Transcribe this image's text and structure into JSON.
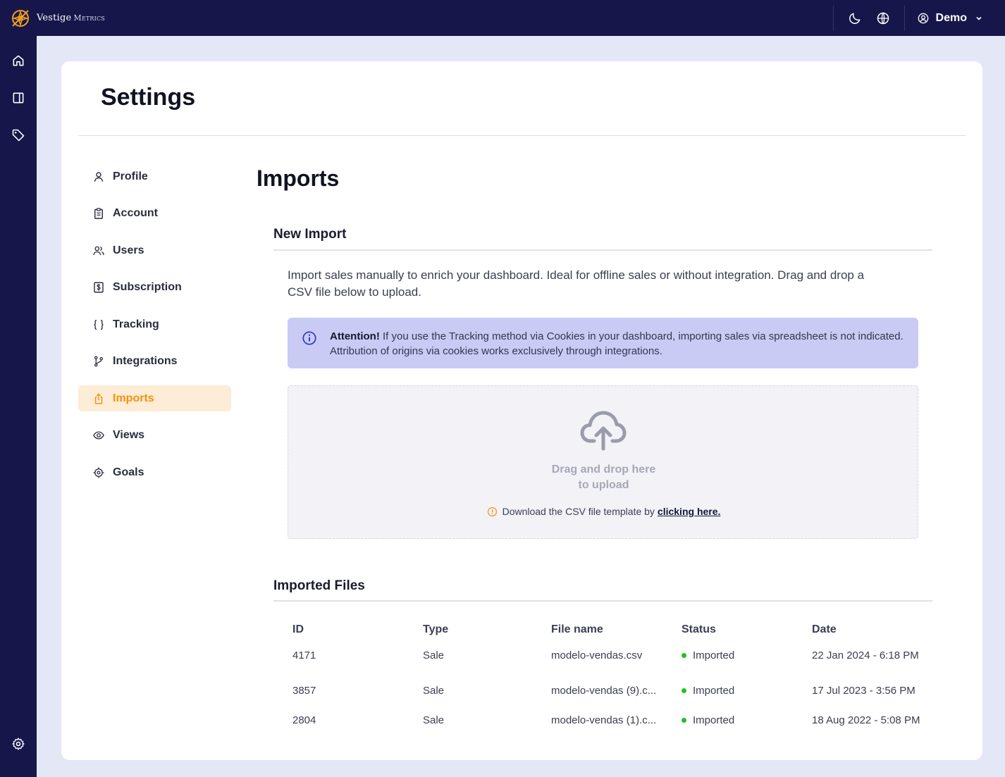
{
  "app": {
    "brand_name": "Vestige",
    "brand_suffix": "Metrics",
    "user_name": "Demo"
  },
  "page": {
    "title": "Settings",
    "section_title": "Imports"
  },
  "nav": {
    "items": [
      {
        "label": "Profile",
        "icon": "user-icon"
      },
      {
        "label": "Account",
        "icon": "clipboard-icon"
      },
      {
        "label": "Users",
        "icon": "users-icon"
      },
      {
        "label": "Subscription",
        "icon": "dollar-icon"
      },
      {
        "label": "Tracking",
        "icon": "braces-icon"
      },
      {
        "label": "Integrations",
        "icon": "git-branch-icon"
      },
      {
        "label": "Imports",
        "icon": "upload-icon",
        "active": true
      },
      {
        "label": "Views",
        "icon": "eye-icon"
      },
      {
        "label": "Goals",
        "icon": "target-icon"
      }
    ]
  },
  "new_import": {
    "title": "New Import",
    "description": "Import sales manually to enrich your dashboard. Ideal for offline sales or without integration. Drag and drop a CSV file below to upload.",
    "alert_bold": "Attention!",
    "alert_text": "If you use the Tracking method via Cookies in your dashboard, importing sales via spreadsheet is not indicated. Attribution of origins via cookies works exclusively through integrations.",
    "drop_line1": "Drag and drop here",
    "drop_line2": "to upload",
    "template_text": "Download the CSV file template by",
    "template_link": "clicking here."
  },
  "imported_files": {
    "title": "Imported Files",
    "columns": [
      "ID",
      "Type",
      "File name",
      "Status",
      "Date"
    ],
    "rows": [
      {
        "id": "4171",
        "type": "Sale",
        "file": "modelo-vendas.csv",
        "status": "Imported",
        "date": "22 Jan 2024 - 6:18 PM"
      },
      {
        "id": "3857",
        "type": "Sale",
        "file": "modelo-vendas (9).c...",
        "status": "Imported",
        "date": "17 Jul 2023 - 3:56 PM"
      },
      {
        "id": "2804",
        "type": "Sale",
        "file": "modelo-vendas (1).c...",
        "status": "Imported",
        "date": "18 Aug 2022 - 5:08 PM"
      }
    ]
  },
  "colors": {
    "topbar": "#16164a",
    "accent": "#f2920f",
    "alert_bg": "#c9cbf5",
    "status_ok": "#21c21c"
  }
}
